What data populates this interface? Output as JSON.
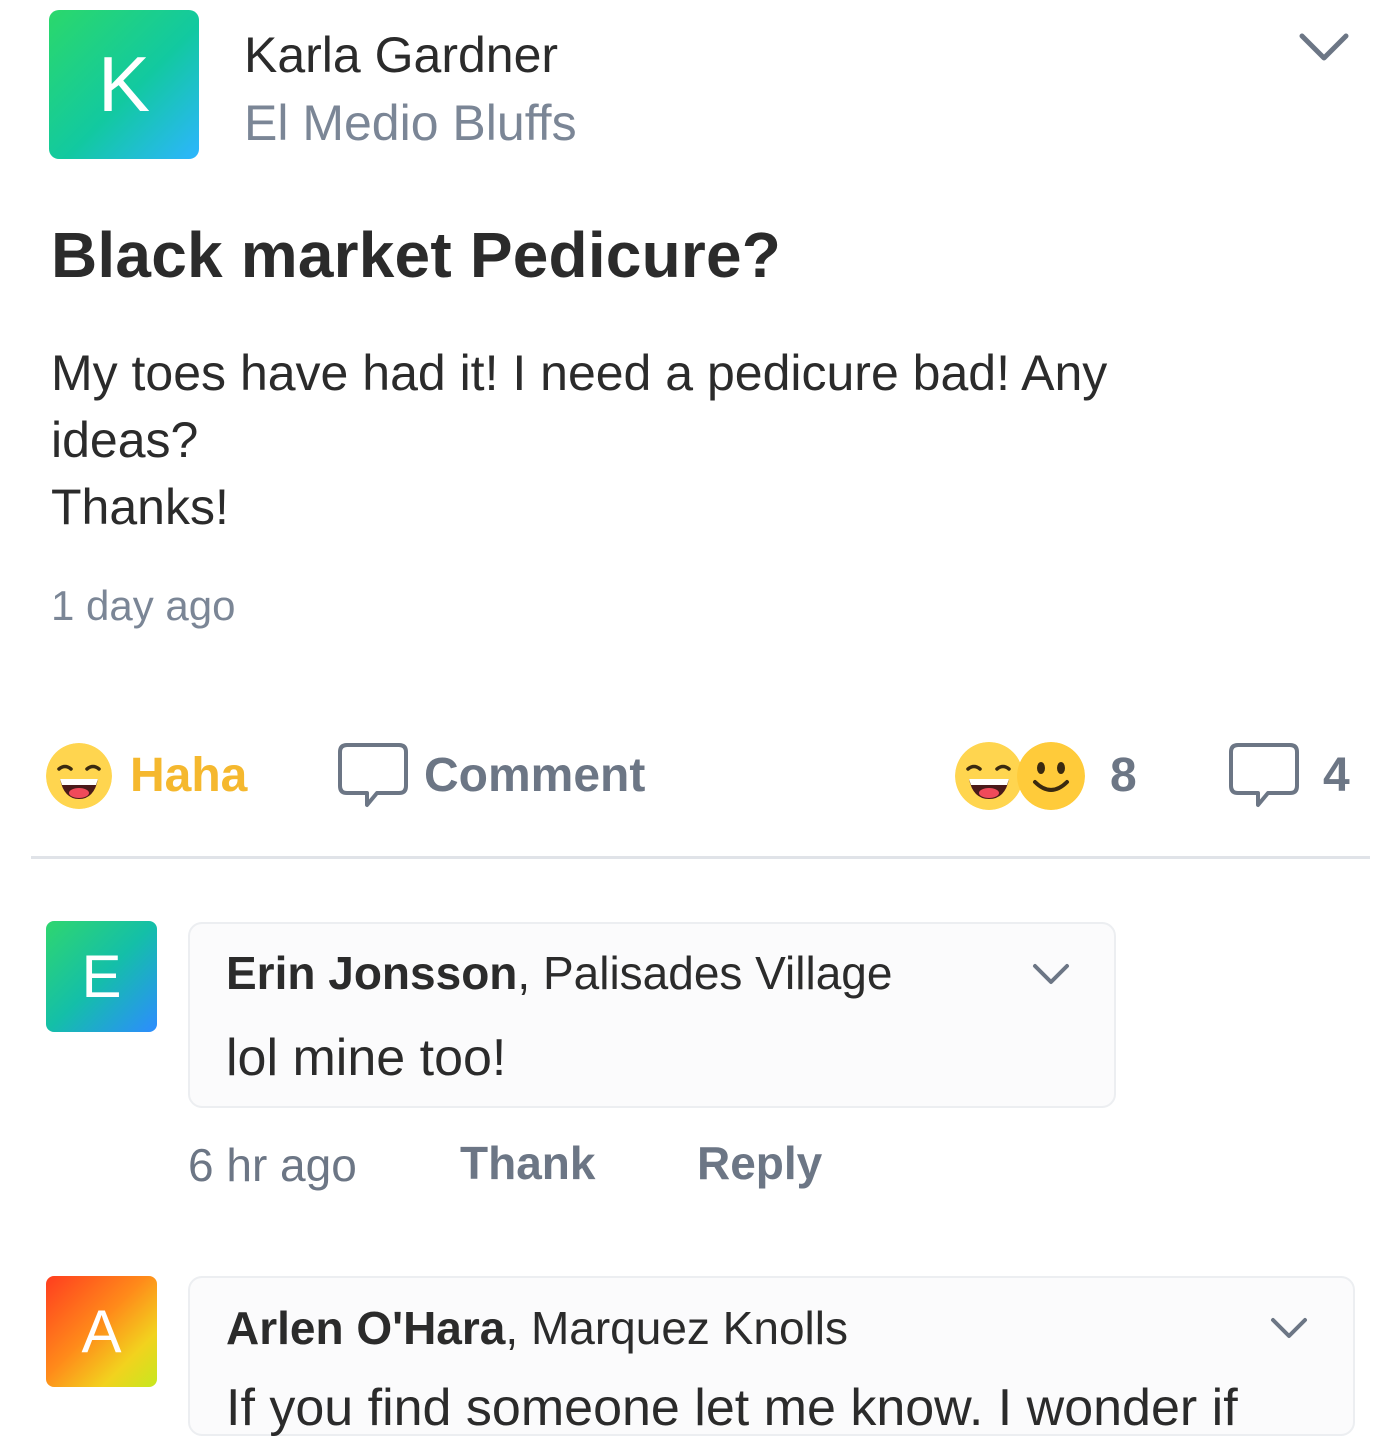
{
  "post": {
    "avatar_letter": "K",
    "author_name": "Karla Gardner",
    "neighborhood": "El Medio Bluffs",
    "title": "Black market Pedicure?",
    "body_lines": [
      "My toes have had it! I need a pedicure bad! Any",
      "ideas?",
      "Thanks!"
    ],
    "timestamp": "1 day ago",
    "menu_icon": "chevron-down-icon"
  },
  "actions": {
    "haha_label": "Haha",
    "comment_label": "Comment",
    "reaction_count": "8",
    "comment_count": "4",
    "icons": [
      "haha-emoji-icon",
      "speech-bubble-icon",
      "smile-emoji-icon"
    ]
  },
  "comments": [
    {
      "avatar_letter": "E",
      "author_name": "Erin Jonsson",
      "neighborhood": "Palisades Village",
      "separator": ", ",
      "text": "lol mine too!",
      "timestamp": "6 hr ago",
      "thank_label": "Thank",
      "reply_label": "Reply"
    },
    {
      "avatar_letter": "A",
      "author_name": "Arlen O'Hara",
      "neighborhood": "Marquez Knolls",
      "separator": ", ",
      "text": "If you find someone let me know. I wonder if"
    }
  ],
  "colors": {
    "haha_accent": "#f5b82e",
    "muted_text": "#6c7685",
    "neighborhood_text": "#7b8696"
  }
}
